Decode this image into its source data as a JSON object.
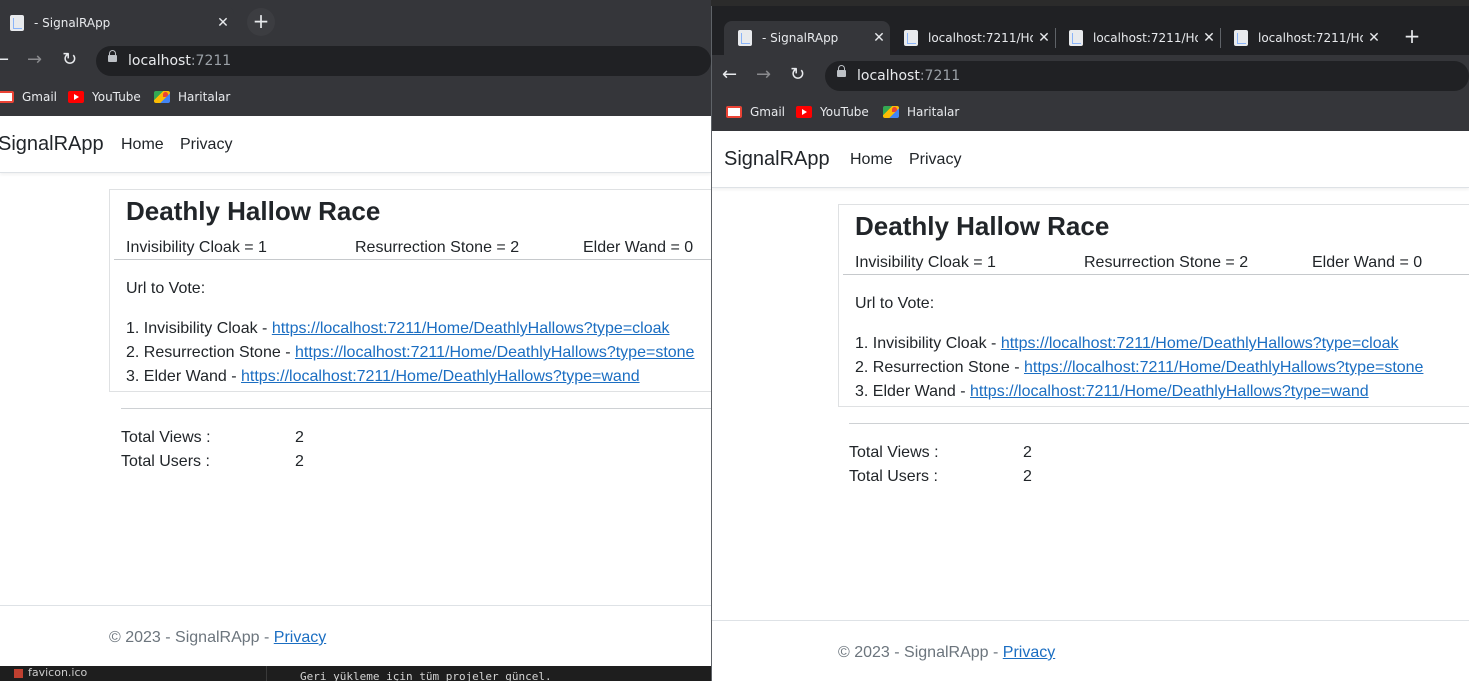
{
  "left_window": {
    "tabs": [
      {
        "title": "- SignalRApp",
        "close": "✕"
      }
    ],
    "new_tab": "+",
    "url_host": "localhost",
    "url_port": ":7211",
    "bookmarks": [
      "Gmail",
      "YouTube",
      "Haritalar"
    ]
  },
  "right_window": {
    "tabs": [
      {
        "title": "- SignalRApp",
        "close": "✕"
      },
      {
        "title": "localhost:7211/Ho",
        "close": "✕"
      },
      {
        "title": "localhost:7211/Ho",
        "close": "✕"
      },
      {
        "title": "localhost:7211/Ho",
        "close": "✕"
      }
    ],
    "new_tab": "+",
    "url_host": "localhost",
    "url_port": ":7211",
    "bookmarks": [
      "Gmail",
      "YouTube",
      "Haritalar"
    ]
  },
  "nav": {
    "back": "←",
    "forward": "→",
    "reload": "↻"
  },
  "site": {
    "brand": "SignalRApp",
    "links": [
      "Home",
      "Privacy"
    ]
  },
  "race": {
    "title": "Deathly Hallow Race",
    "scores": [
      {
        "label": "Invisibility Cloak = 1"
      },
      {
        "label": "Resurrection Stone = 2"
      },
      {
        "label": "Elder Wand = 0"
      }
    ],
    "url_to_vote": "Url to Vote:",
    "vote_links": [
      {
        "prefix": "1. Invisibility Cloak - ",
        "url": "https://localhost:7211/Home/DeathlyHallows?type=cloak"
      },
      {
        "prefix": "2. Resurrection Stone - ",
        "url": "https://localhost:7211/Home/DeathlyHallows?type=stone"
      },
      {
        "prefix": "3. Elder Wand - ",
        "url": "https://localhost:7211/Home/DeathlyHallows?type=wand"
      }
    ]
  },
  "stats": {
    "views_label": "Total Views :",
    "views_value": "2",
    "users_label": "Total Users :",
    "users_value": "2"
  },
  "footer": {
    "text": "© 2023 - SignalRApp - ",
    "link": "Privacy"
  },
  "console": {
    "file": "favicon.ico",
    "line": "Geri yükleme için tüm projeler güncel."
  }
}
